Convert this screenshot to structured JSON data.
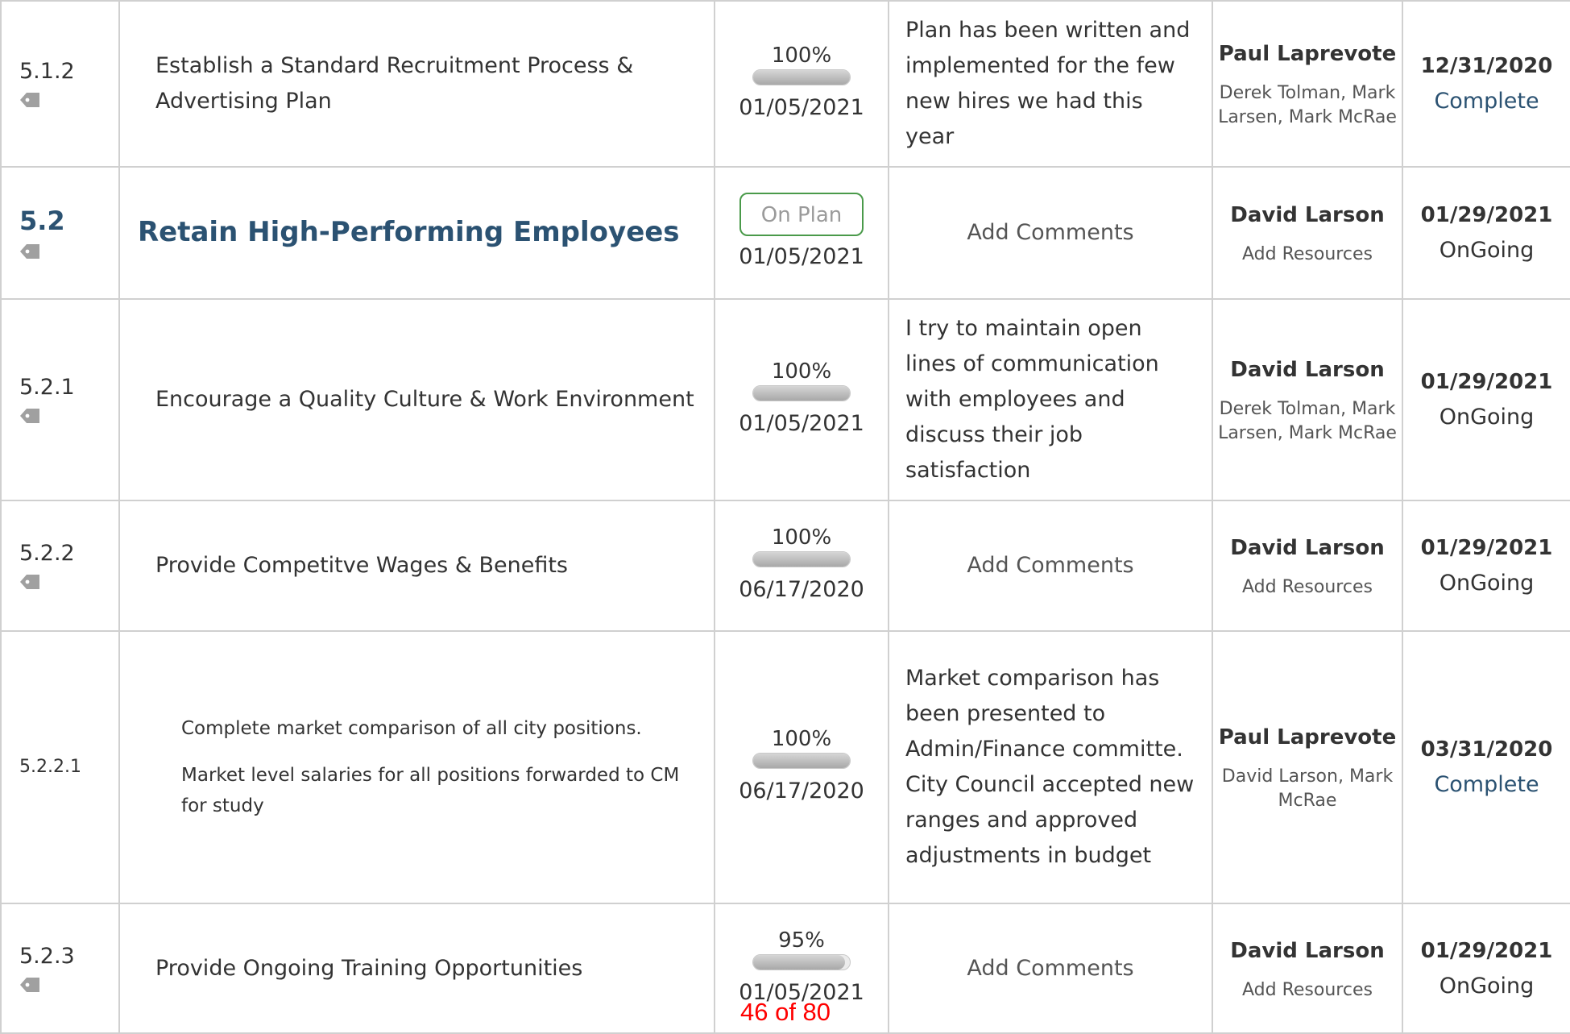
{
  "rows": [
    {
      "num": "5.1.2",
      "title": "Establish a Standard Recruitment Process & Advertising Plan",
      "percent_label": "100%",
      "percent": 100,
      "status_date": "01/05/2021",
      "comment": "Plan has been written and implemented for the few new hires we had this year",
      "owner": "Paul Laprevote",
      "resources": "Derek Tolman, Mark Larsen, Mark McRae",
      "due_date": "12/31/2020",
      "due_status": "Complete"
    },
    {
      "num": "5.2",
      "title": "Retain High-Performing Employees",
      "status_pill": "On Plan",
      "status_date": "01/05/2021",
      "comment": "Add Comments",
      "owner": "David Larson",
      "resources": "Add Resources",
      "due_date": "01/29/2021",
      "due_status": "OnGoing"
    },
    {
      "num": "5.2.1",
      "title": "Encourage a Quality Culture & Work Environment",
      "percent_label": "100%",
      "percent": 100,
      "status_date": "01/05/2021",
      "comment": "I try to maintain open lines of communication with employees and discuss their job satisfaction",
      "owner": "David Larson",
      "resources": "Derek Tolman, Mark Larsen, Mark McRae",
      "due_date": "01/29/2021",
      "due_status": "OnGoing"
    },
    {
      "num": "5.2.2",
      "title": "Provide Competitve Wages & Benefits",
      "percent_label": "100%",
      "percent": 100,
      "status_date": "06/17/2020",
      "comment": "Add Comments",
      "owner": "David Larson",
      "resources": "Add Resources",
      "due_date": "01/29/2021",
      "due_status": "OnGoing"
    },
    {
      "num": "5.2.2.1",
      "title_line1": "Complete market comparison of all city positions.",
      "title_line2": "Market level salaries for all positions forwarded to CM for study",
      "percent_label": "100%",
      "percent": 100,
      "status_date": "06/17/2020",
      "comment": "Market comparison has been presented to Admin/Finance committe. City Council accepted new ranges and approved adjustments in budget",
      "owner": "Paul Laprevote",
      "resources": "David Larson, Mark McRae",
      "due_date": "03/31/2020",
      "due_status": "Complete"
    },
    {
      "num": "5.2.3",
      "title": "Provide Ongoing Training Opportunities",
      "percent_label": "95%",
      "percent": 95,
      "status_date": "01/05/2021",
      "comment": "Add Comments",
      "owner": "David Larson",
      "resources": "Add Resources",
      "due_date": "01/29/2021",
      "due_status": "OnGoing"
    }
  ],
  "pager": "46 of 80",
  "colors": {
    "section_blue": "#2b5272",
    "pill_border": "#4a9a4a",
    "pager_red": "#ff0000",
    "grid": "#d0d0d0"
  },
  "icons": {
    "tag": "tag-icon"
  }
}
